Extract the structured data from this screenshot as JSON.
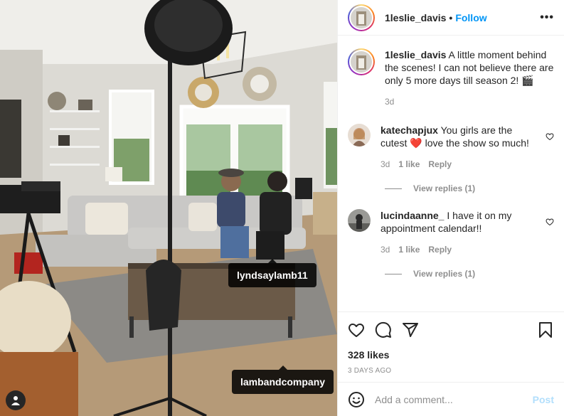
{
  "post": {
    "username": "1leslie_davis",
    "follow_label": "Follow",
    "more_label": "•••",
    "caption": "A little moment behind the scenes! I can not believe there are only 5 more days till season 2! 🎬",
    "caption_age": "3d"
  },
  "photo_tags": [
    {
      "label": "lyndsaylamb11"
    },
    {
      "label": "lambandcompany"
    }
  ],
  "comments": [
    {
      "username": "katechapjux",
      "text_before": "You girls are the cutest",
      "emoji": "❤️",
      "text_after": "love the show so much!",
      "age": "3d",
      "likes": "1 like",
      "reply_label": "Reply",
      "view_replies": "View replies (1)"
    },
    {
      "username": "lucindaanne_",
      "text": "I have it on my appointment calendar!!",
      "age": "3d",
      "likes": "1 like",
      "reply_label": "Reply",
      "view_replies": "View replies (1)"
    }
  ],
  "actions": {
    "likes_count": "328 likes",
    "date": "3 DAYS AGO"
  },
  "add_comment": {
    "placeholder": "Add a comment...",
    "post_label": "Post"
  },
  "colors": {
    "accent": "#0095f6",
    "heart_emoji": "#e0245e",
    "muted": "#8e8e8e",
    "post_disabled": "#b2dffc"
  },
  "icons": [
    "heart-icon",
    "comment-icon",
    "share-icon",
    "bookmark-icon",
    "emoji-icon",
    "user-tag-icon",
    "small-heart-icon"
  ]
}
